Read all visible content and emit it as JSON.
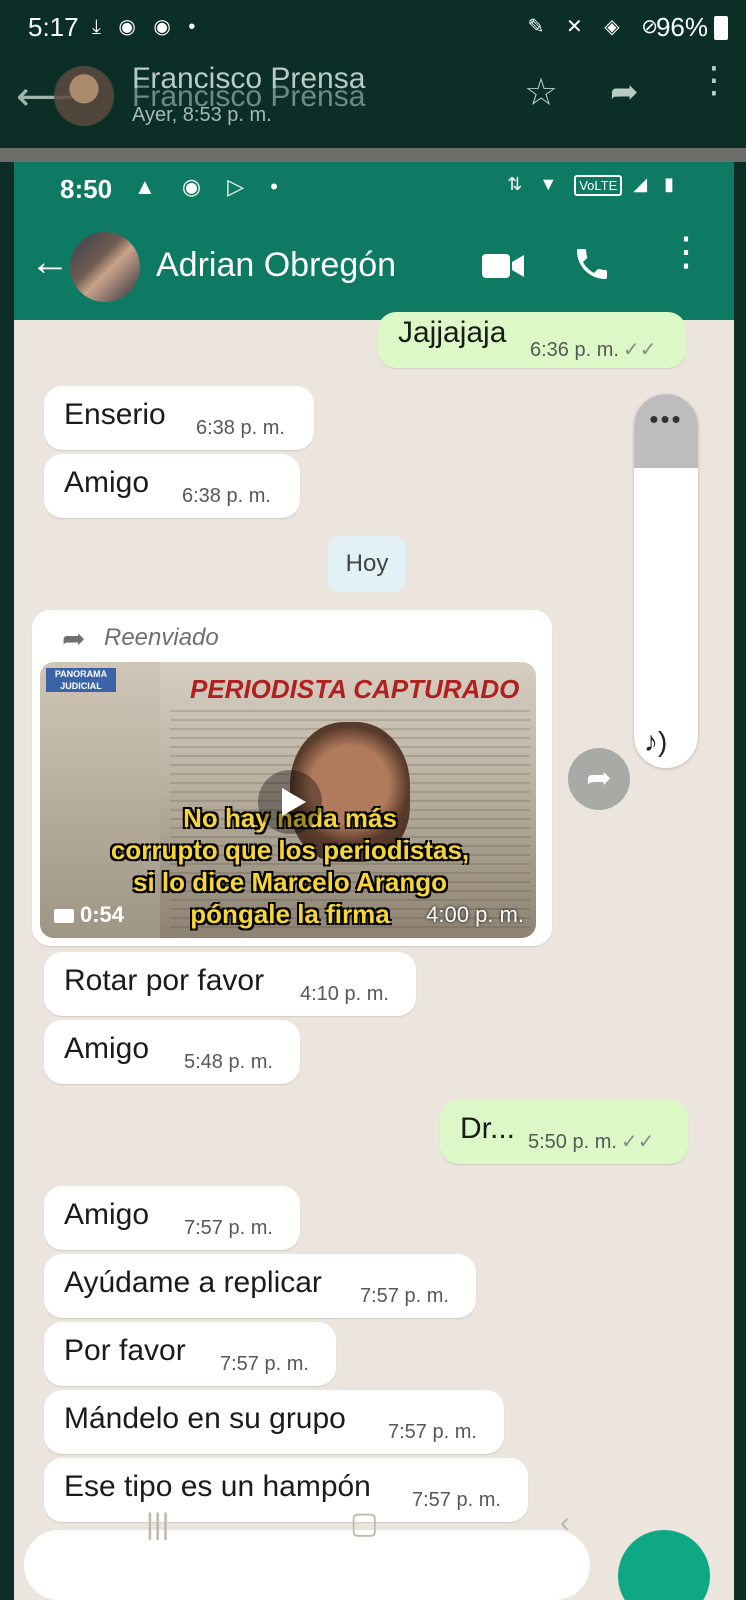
{
  "outer_status": {
    "time": "5:17",
    "left_icons": "⤓ ◉ ◉ •",
    "right_icons": "✎ ✕ ◈ ⊘",
    "battery": "96%"
  },
  "outer_header": {
    "name": "Francisco Prensa",
    "name_ghost": "Francisco Prensa",
    "subtitle": "Ayer, 8:53 p. m.",
    "icons": [
      "back-icon",
      "star-icon",
      "share-icon",
      "more-icon"
    ]
  },
  "inner_status": {
    "time": "8:50",
    "icons": "▲ ◉ ▷ •",
    "volte": "VoLTE"
  },
  "chat_header": {
    "contact_name": "Adrian Obregón",
    "icons": [
      "back-icon",
      "video-call-icon",
      "phone-icon",
      "more-icon"
    ]
  },
  "messages": [
    {
      "dir": "out",
      "text": "Jajjajaja",
      "time": "6:36 p. m."
    },
    {
      "dir": "in",
      "text": "Enserio",
      "time": "6:38 p. m."
    },
    {
      "dir": "in",
      "text": "Amigo",
      "time": "6:38 p. m."
    },
    {
      "dir": "in",
      "text": "Rotar por favor",
      "time": "4:10 p. m."
    },
    {
      "dir": "in",
      "text": "Amigo",
      "time": "5:48 p. m."
    },
    {
      "dir": "out",
      "text": "Dr...",
      "time": "5:50 p. m."
    },
    {
      "dir": "in",
      "text": "Amigo",
      "time": "7:57 p. m."
    },
    {
      "dir": "in",
      "text": "Ayúdame a replicar",
      "time": "7:57 p. m."
    },
    {
      "dir": "in",
      "text": "Por favor",
      "time": "7:57 p. m."
    },
    {
      "dir": "in",
      "text": "Mándelo en su grupo",
      "time": "7:57 p. m."
    },
    {
      "dir": "in",
      "text": "Ese tipo es un hampón",
      "time": "7:57 p. m."
    }
  ],
  "ticks": "✓✓",
  "day_chip": "Hoy",
  "forwarded": {
    "label": "Reenviado",
    "headline": "PERIODISTA CAPTURADO",
    "tag": "PANORAMA JUDICIAL",
    "caption": [
      "No hay nada más",
      "corrupto que los periodistas,",
      "si lo dice Marcelo Arango",
      "póngale la firma"
    ],
    "duration": "0:54",
    "time": "4:00 p. m."
  },
  "side_panel": {
    "dots": "•••",
    "note": "♪)"
  }
}
